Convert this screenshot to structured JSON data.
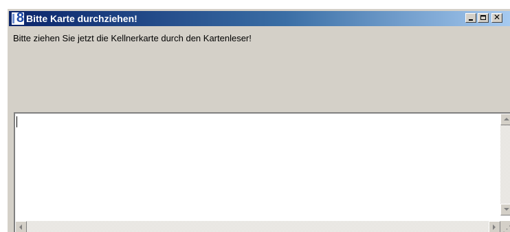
{
  "window": {
    "title": "Bitte Karte durchziehen!",
    "icon": "app-logo-8-icon",
    "buttons": {
      "minimize": "minimize-icon",
      "maximize": "maximize-icon",
      "close": "✕"
    }
  },
  "message": "Bitte ziehen Sie jetzt die Kellnerkarte durch den Kartenleser!",
  "input": {
    "value": ""
  },
  "colors": {
    "titlebar_start": "#0a246a",
    "titlebar_end": "#a6caf0",
    "face": "#d4d0c8"
  }
}
